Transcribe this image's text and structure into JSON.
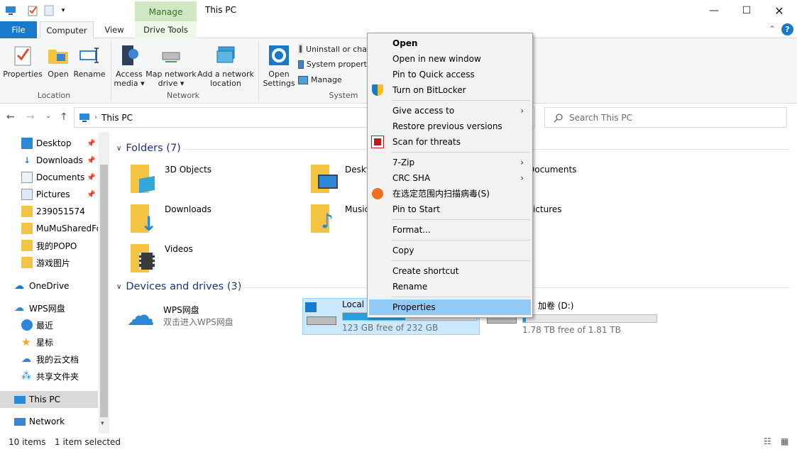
{
  "window": {
    "title": "This PC",
    "context_tab": "Manage"
  },
  "tabs": {
    "file": "File",
    "computer": "Computer",
    "view": "View",
    "drive_tools": "Drive Tools"
  },
  "ribbon": {
    "location": {
      "properties": "Properties",
      "open": "Open",
      "rename": "Rename",
      "group": "Location"
    },
    "network": {
      "access_media_1": "Access",
      "access_media_2": "media",
      "map_drive_1": "Map network",
      "map_drive_2": "drive",
      "add_location_1": "Add a network",
      "add_location_2": "location",
      "group": "Network"
    },
    "system": {
      "open_settings_1": "Open",
      "open_settings_2": "Settings",
      "uninstall": "Uninstall or cha",
      "system_props": "System propert",
      "manage": "Manage",
      "group": "System"
    }
  },
  "address": {
    "path": "This PC",
    "search_placeholder": "Search This PC"
  },
  "nav": {
    "items": [
      {
        "label": "Desktop",
        "pinned": true
      },
      {
        "label": "Downloads",
        "pinned": true
      },
      {
        "label": "Documents",
        "pinned": true
      },
      {
        "label": "Pictures",
        "pinned": true
      },
      {
        "label": "239051574"
      },
      {
        "label": "MuMuSharedFo"
      },
      {
        "label": "我的POPO"
      },
      {
        "label": "游戏图片"
      },
      {
        "label": "OneDrive"
      },
      {
        "label": "WPS网盘"
      },
      {
        "label": "最近"
      },
      {
        "label": "星标"
      },
      {
        "label": "我的云文档"
      },
      {
        "label": "共享文件夹"
      },
      {
        "label": "This PC"
      },
      {
        "label": "Network"
      }
    ]
  },
  "content": {
    "folders_header": "Folders (7)",
    "folders": [
      {
        "name": "3D Objects"
      },
      {
        "name": "Desktop"
      },
      {
        "name": "Documents"
      },
      {
        "name": "Downloads"
      },
      {
        "name": "Music"
      },
      {
        "name": "Pictures"
      },
      {
        "name": "Videos"
      }
    ],
    "drives_header": "Devices and drives (3)",
    "drives": [
      {
        "name": "WPS网盘",
        "sub": "双击进入WPS网盘"
      },
      {
        "name": "Local D",
        "sub": "123 GB free of 232 GB",
        "used_pct": 47
      },
      {
        "name": "加卷 (D:)",
        "sub": "1.78 TB free of 1.81 TB",
        "used_pct": 2
      }
    ]
  },
  "context_menu": {
    "items": [
      "Open",
      "Open in new window",
      "Pin to Quick access",
      "Turn on BitLocker",
      "Give access to",
      "Restore previous versions",
      "Scan for threats",
      "7-Zip",
      "CRC SHA",
      "在选定范围内扫描病毒(S)",
      "Pin to Start",
      "Format...",
      "Copy",
      "Create shortcut",
      "Rename",
      "Properties"
    ]
  },
  "status": {
    "count": "10 items",
    "selected": "1 item selected"
  },
  "colors": {
    "accent": "#1979ca",
    "selection": "#cce8ff",
    "menu_highlight": "#91c9f7",
    "drive_bar": "#26a0da"
  }
}
